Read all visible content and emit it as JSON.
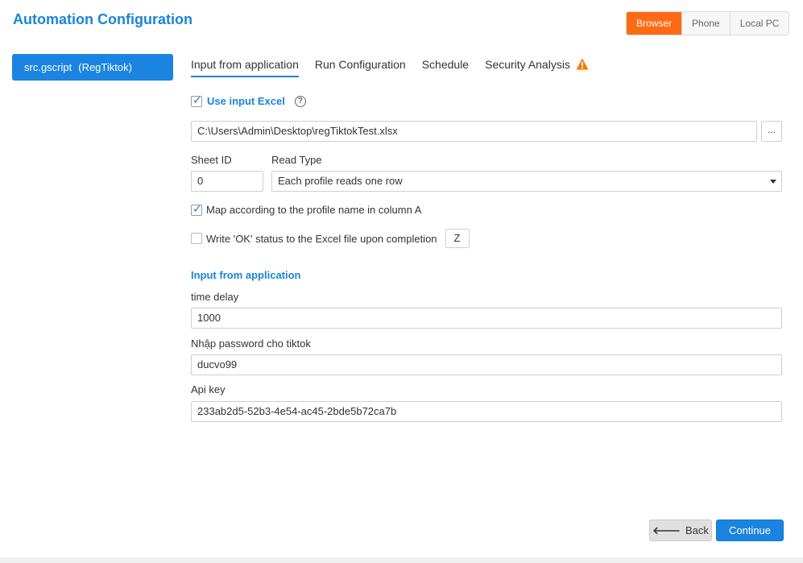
{
  "header": {
    "title": "Automation Configuration"
  },
  "mode_toggle": {
    "options": [
      "Browser",
      "Phone",
      "Local PC"
    ],
    "selected": "Browser"
  },
  "sidebar": {
    "script": {
      "name": "src.gscript",
      "tag": "(RegTiktok)"
    }
  },
  "tabs": [
    {
      "label": "Input from application",
      "active": true
    },
    {
      "label": "Run Configuration"
    },
    {
      "label": "Schedule"
    },
    {
      "label": "Security Analysis",
      "icon": "warning-icon"
    }
  ],
  "excel": {
    "use_label": "Use input Excel",
    "use_checked": true,
    "help_icon": "?",
    "file_path": "C:\\Users\\Admin\\Desktop\\regTiktokTest.xlsx",
    "browse_label": "...",
    "sheet_id_label": "Sheet ID",
    "sheet_id_value": "0",
    "read_type_label": "Read Type",
    "read_type_value": "Each profile reads one row",
    "map_label": "Map according to the profile name in column A",
    "map_checked": true,
    "write_ok_label": "Write 'OK' status to the Excel file upon completion",
    "write_ok_checked": false,
    "write_ok_column": "Z"
  },
  "inputs_section": {
    "title": "Input from application",
    "fields": [
      {
        "label": "time delay",
        "value": "1000"
      },
      {
        "label": "Nhập password cho tiktok",
        "value": "ducvo99"
      },
      {
        "label": "Api key",
        "value": "233ab2d5-52b3-4e54-ac45-2bde5b72ca7b"
      }
    ]
  },
  "footer": {
    "back_label": "Back",
    "continue_label": "Continue"
  },
  "colors": {
    "accent": "#1a84d6",
    "primary_button": "#1a84e0",
    "active_mode": "#ff6a13",
    "warning": "#f07c00"
  }
}
